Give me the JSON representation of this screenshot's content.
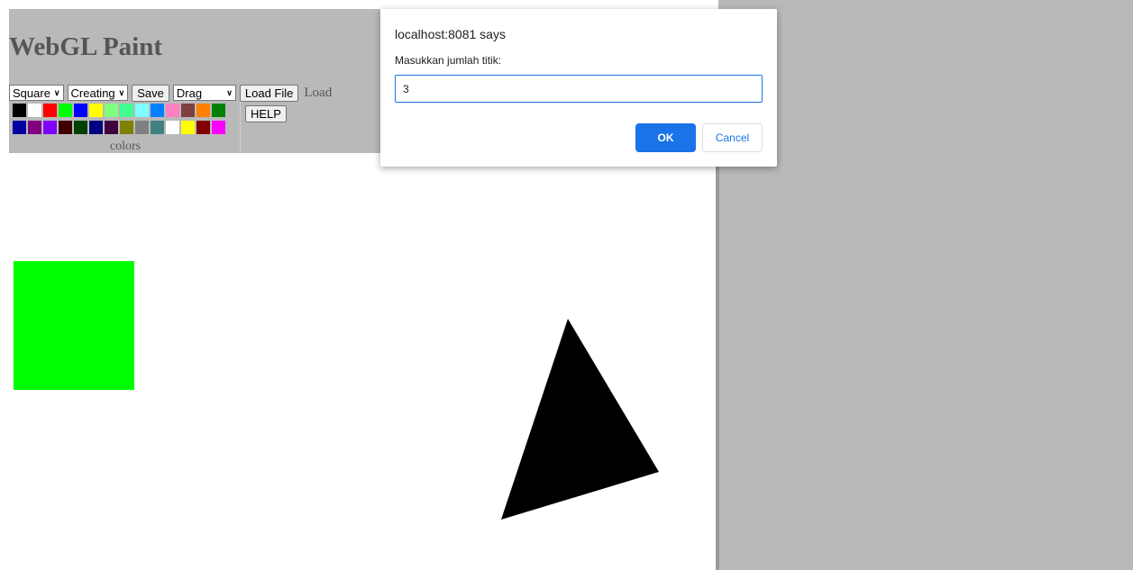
{
  "app": {
    "title": "WebGL Paint"
  },
  "toolbar": {
    "shape_select": "Square",
    "mode_select": "Creating",
    "save_label": "Save",
    "drag_select": "Drag",
    "load_file_label": "Load File",
    "load_text": "Load",
    "help_label": "HELP"
  },
  "palette": {
    "label": "colors",
    "row1": [
      "#000000",
      "#ffffff",
      "#ff0000",
      "#00ff00",
      "#0000ff",
      "#ffff00",
      "#80ff80",
      "#40ff90",
      "#80ffff",
      "#0080ff",
      "#ff80c0",
      "#804040",
      "#ff8000",
      "#008000"
    ],
    "row2": [
      "#0000a0",
      "#800080",
      "#8000ff",
      "#400000",
      "#004000",
      "#000080",
      "#400040",
      "#808000",
      "#808080",
      "#408080",
      "#ffffff",
      "#ffff00",
      "#800000",
      "#ff00ff"
    ]
  },
  "canvas": {
    "square_color": "#00ff00",
    "triangle_color": "#000000"
  },
  "dialog": {
    "title": "localhost:8081 says",
    "message": "Masukkan jumlah titik:",
    "input_value": "3",
    "ok_label": "OK",
    "cancel_label": "Cancel"
  }
}
